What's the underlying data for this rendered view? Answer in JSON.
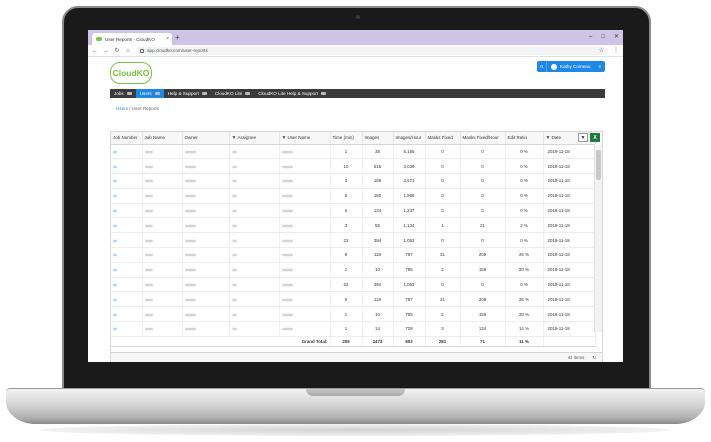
{
  "browser": {
    "tab_title": "User Reports - CloudKO",
    "tab_close": "×",
    "new_tab": "+",
    "window_controls": [
      "–",
      "□",
      "✕"
    ],
    "url": "app.cloudko.com/user-reports"
  },
  "app": {
    "logo": "CloudKO",
    "user": {
      "count": "0",
      "name": "Kathy Comeau"
    }
  },
  "menu": [
    {
      "label": "Jobs",
      "active": false
    },
    {
      "label": "Users",
      "active": true
    },
    {
      "label": "Help & Support",
      "active": false
    },
    {
      "label": "CloudKO Lite",
      "active": false
    },
    {
      "label": "CloudKO Lite Help & Support",
      "active": false
    }
  ],
  "breadcrumb": {
    "parent": "Users",
    "separator": "/",
    "current": "User Reports"
  },
  "grid": {
    "columns": [
      "Job Number",
      "Job Name",
      "Owner",
      "Assignee",
      "User Name",
      "Time (min)",
      "Images",
      "Images/Hour",
      "Masks Fixed",
      "Masks Fixed/Hour",
      "Edit Ratio",
      "Date"
    ],
    "filter_glyph": "▼",
    "rows": [
      {
        "time": "1",
        "images": "38",
        "iph": "5,165",
        "masks": "0",
        "mph": "0",
        "ratio": "0 %",
        "date": "2019-11-18"
      },
      {
        "time": "10",
        "images": "515",
        "iph": "3,039",
        "masks": "0",
        "mph": "0",
        "ratio": "0 %",
        "date": "2019-11-18"
      },
      {
        "time": "3",
        "images": "155",
        "iph": "2,671",
        "masks": "0",
        "mph": "0",
        "ratio": "0 %",
        "date": "2019-11-18"
      },
      {
        "time": "5",
        "images": "180",
        "iph": "1,968",
        "masks": "0",
        "mph": "0",
        "ratio": "0 %",
        "date": "2019-11-18"
      },
      {
        "time": "6",
        "images": "134",
        "iph": "1,237",
        "masks": "0",
        "mph": "0",
        "ratio": "0 %",
        "date": "2019-11-18"
      },
      {
        "time": "3",
        "images": "55",
        "iph": "1,134",
        "masks": "1",
        "mph": "21",
        "ratio": "2 %",
        "date": "2019-11-18"
      },
      {
        "time": "22",
        "images": "394",
        "iph": "1,053",
        "masks": "0",
        "mph": "0",
        "ratio": "0 %",
        "date": "2019-11-18"
      },
      {
        "time": "9",
        "images": "118",
        "iph": "797",
        "masks": "31",
        "mph": "209",
        "ratio": "26 %",
        "date": "2019-11-18"
      },
      {
        "time": "1",
        "images": "10",
        "iph": "795",
        "masks": "2",
        "mph": "159",
        "ratio": "20 %",
        "date": "2019-11-18"
      },
      {
        "time": "22",
        "images": "394",
        "iph": "1,053",
        "masks": "0",
        "mph": "0",
        "ratio": "0 %",
        "date": "2019-11-18"
      },
      {
        "time": "9",
        "images": "118",
        "iph": "797",
        "masks": "31",
        "mph": "209",
        "ratio": "26 %",
        "date": "2019-11-18"
      },
      {
        "time": "1",
        "images": "10",
        "iph": "795",
        "masks": "2",
        "mph": "159",
        "ratio": "20 %",
        "date": "2019-11-18"
      },
      {
        "time": "1",
        "images": "14",
        "iph": "728",
        "masks": "3",
        "mph": "134",
        "ratio": "14 %",
        "date": "2019-11-18"
      }
    ],
    "totals": {
      "label": "Grand Total:",
      "time": "205",
      "images": "2473",
      "iph": "602",
      "masks": "281",
      "mph": "71",
      "ratio": "11 %"
    },
    "footer": {
      "items": "41 items",
      "refresh_glyph": "↻"
    },
    "tool_filter": "▼",
    "tool_excel": "X"
  }
}
